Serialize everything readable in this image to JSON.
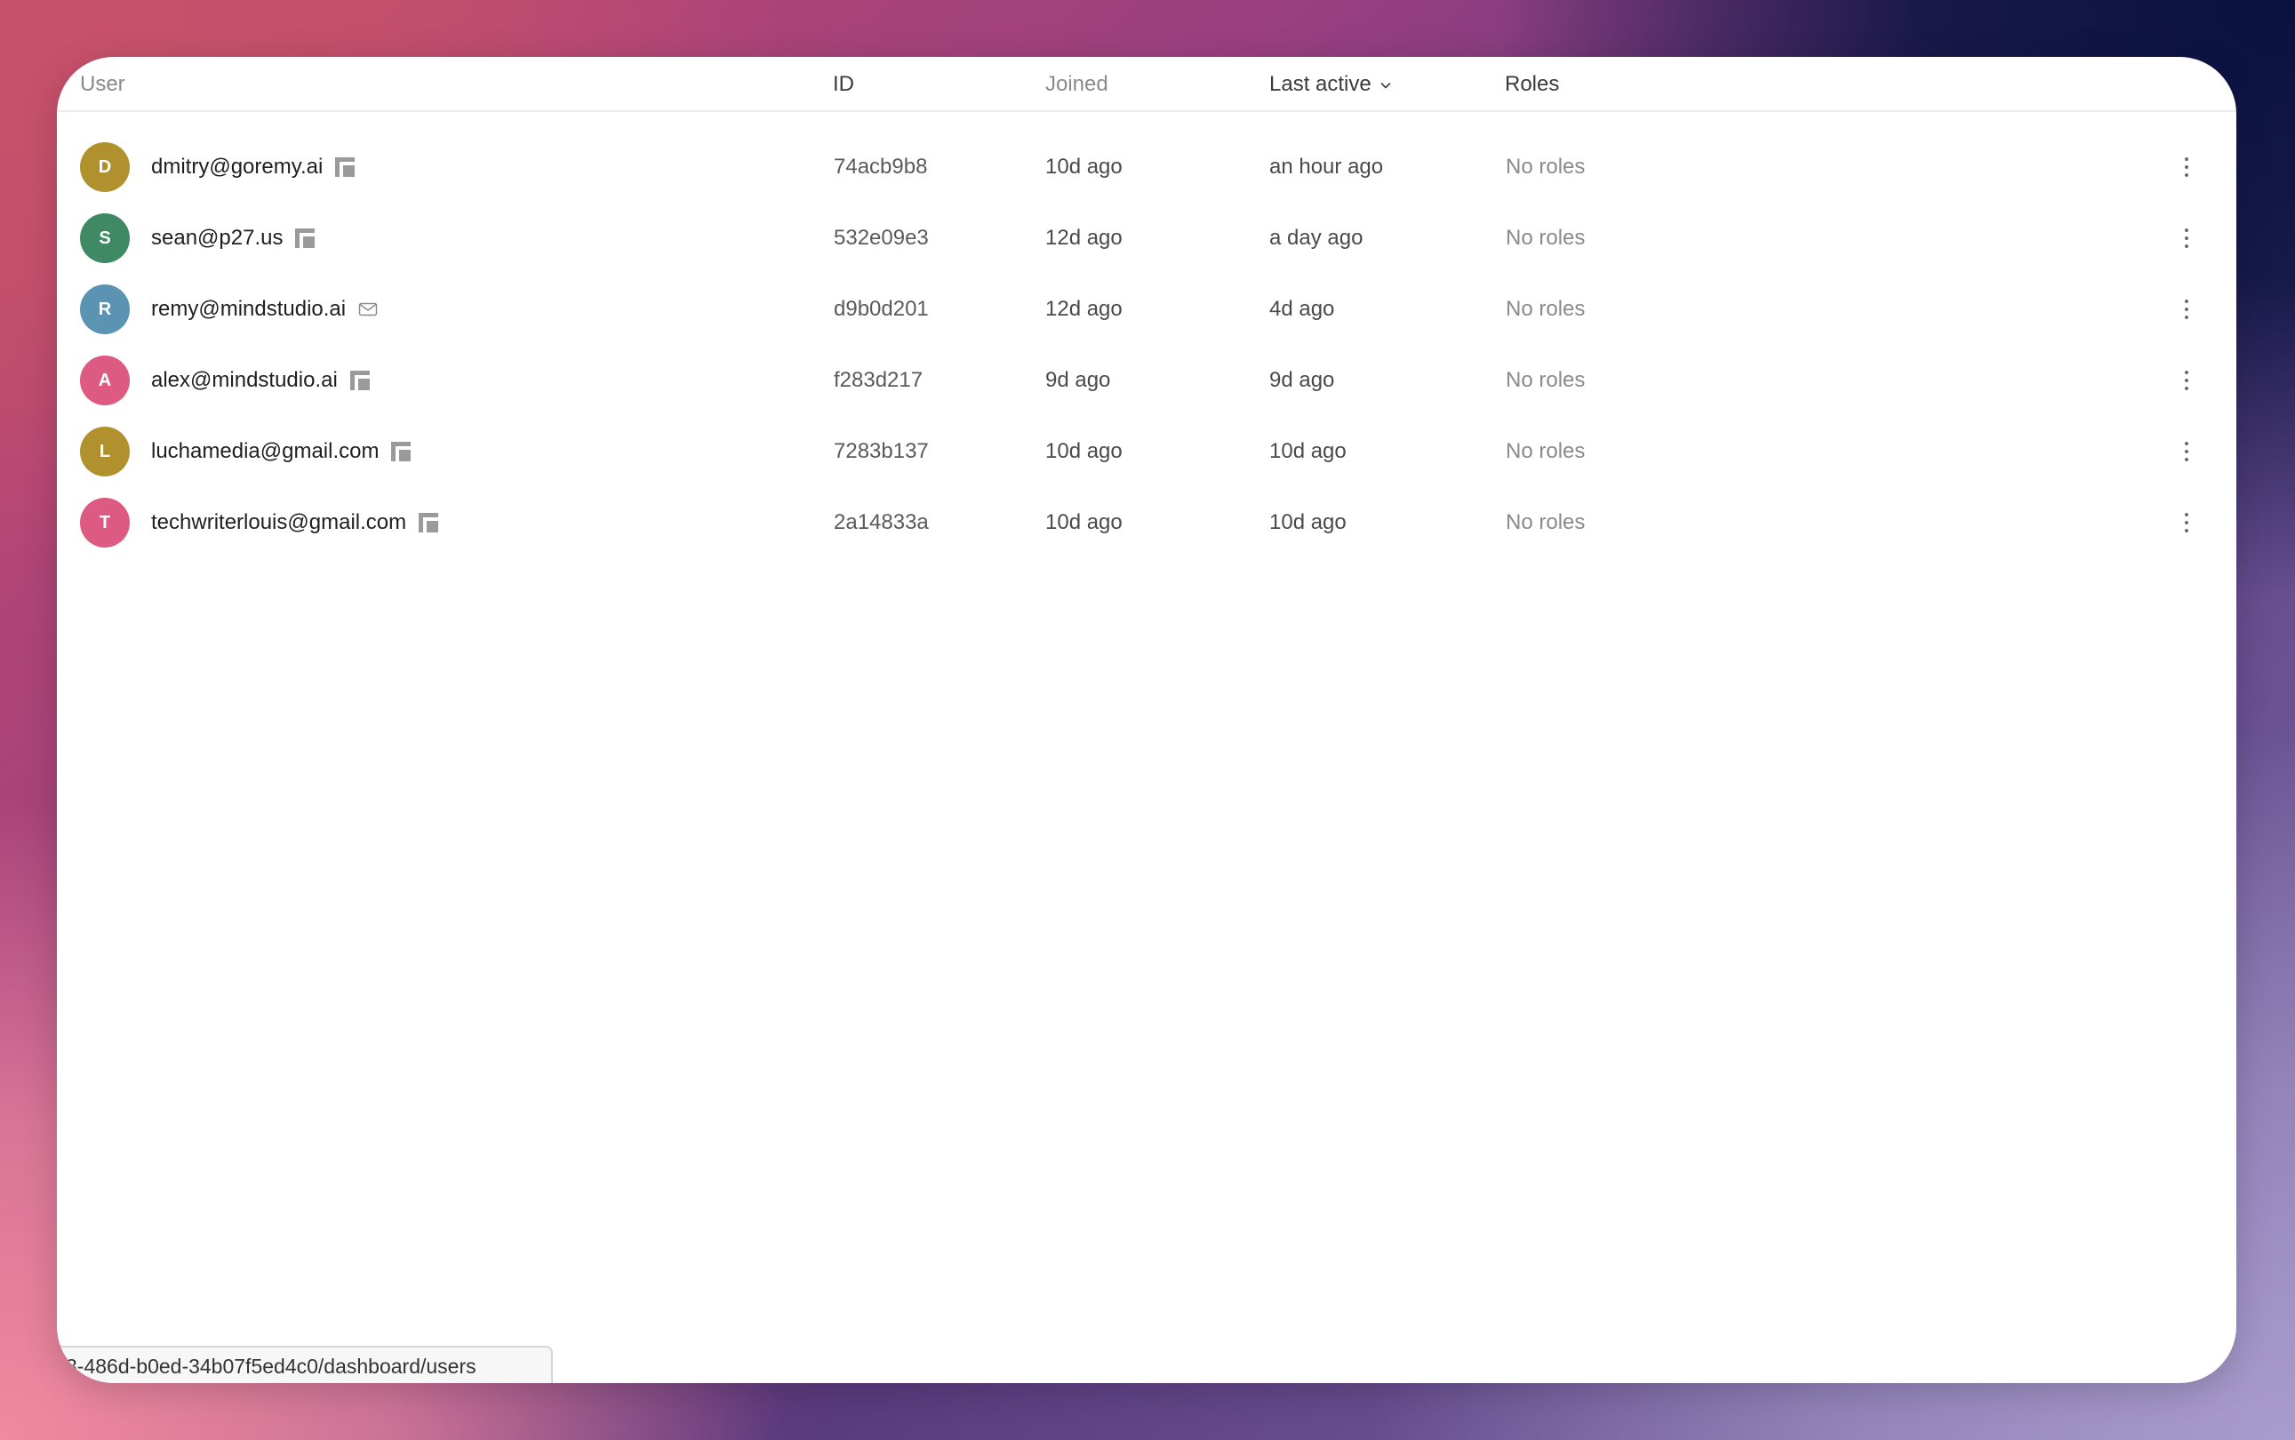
{
  "table": {
    "columns": {
      "user": "User",
      "id": "ID",
      "joined": "Joined",
      "last_active": "Last active",
      "roles": "Roles"
    },
    "sort_indicator_icon": "chevron-down-icon",
    "rows": [
      {
        "initial": "D",
        "avatar_color": "#b0912e",
        "email": "dmitry@goremy.ai",
        "provider_icon": "microsoft-icon",
        "id": "74acb9b8",
        "joined": "10d ago",
        "last_active": "an hour ago",
        "roles": "No roles"
      },
      {
        "initial": "S",
        "avatar_color": "#3f8a65",
        "email": "sean@p27.us",
        "provider_icon": "microsoft-icon",
        "id": "532e09e3",
        "joined": "12d ago",
        "last_active": "a day ago",
        "roles": "No roles"
      },
      {
        "initial": "R",
        "avatar_color": "#5b93b3",
        "email": "remy@mindstudio.ai",
        "provider_icon": "mail-icon",
        "id": "d9b0d201",
        "joined": "12d ago",
        "last_active": "4d ago",
        "roles": "No roles"
      },
      {
        "initial": "A",
        "avatar_color": "#dd5a82",
        "email": "alex@mindstudio.ai",
        "provider_icon": "microsoft-icon",
        "id": "f283d217",
        "joined": "9d ago",
        "last_active": "9d ago",
        "roles": "No roles"
      },
      {
        "initial": "L",
        "avatar_color": "#b0912e",
        "email": "luchamedia@gmail.com",
        "provider_icon": "microsoft-icon",
        "id": "7283b137",
        "joined": "10d ago",
        "last_active": "10d ago",
        "roles": "No roles"
      },
      {
        "initial": "T",
        "avatar_color": "#dd5a82",
        "email": "techwriterlouis@gmail.com",
        "provider_icon": "microsoft-icon",
        "id": "2a14833a",
        "joined": "10d ago",
        "last_active": "10d ago",
        "roles": "No roles"
      }
    ]
  },
  "status_bar": {
    "url": "3-486d-b0ed-34b07f5ed4c0/dashboard/users"
  }
}
